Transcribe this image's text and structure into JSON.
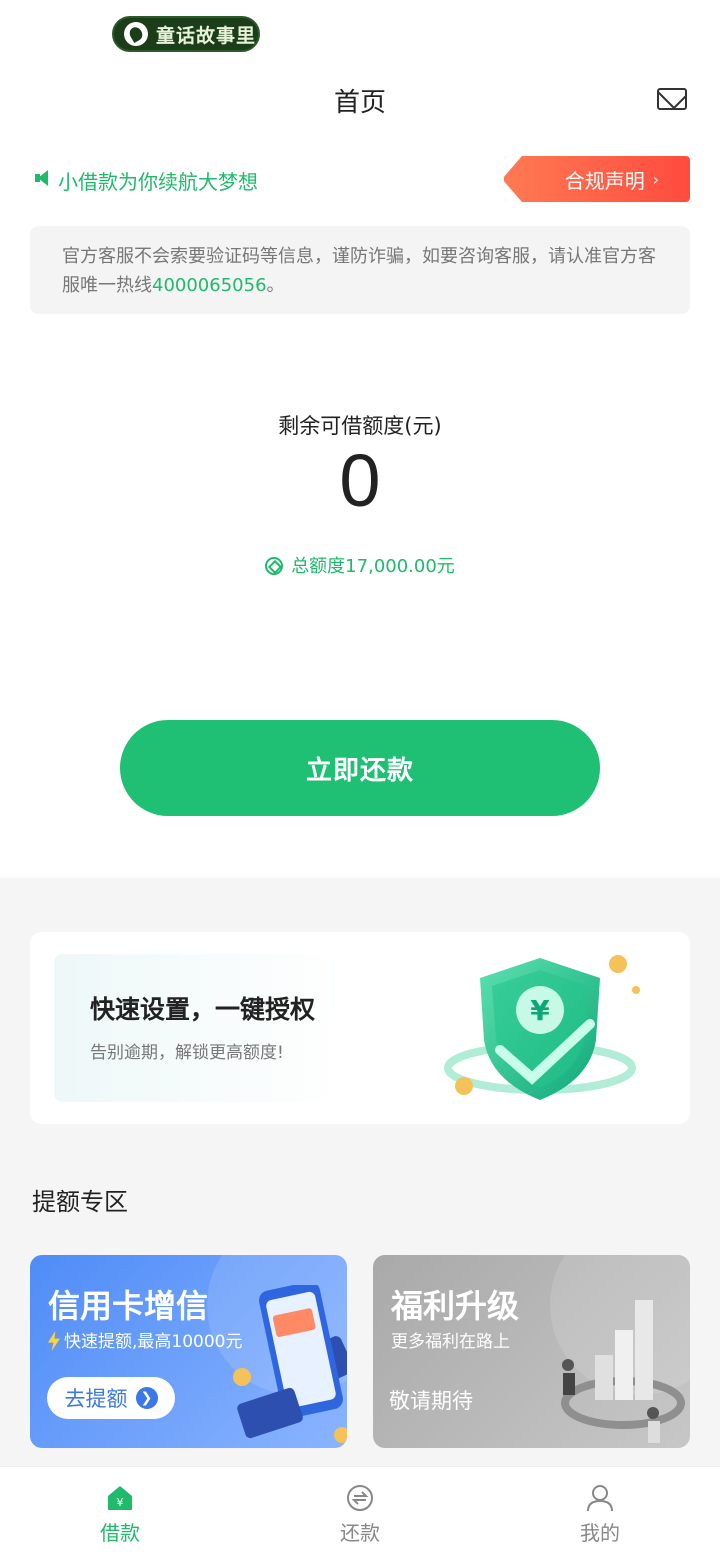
{
  "status_bar": {
    "app_label": "童话故事里"
  },
  "header": {
    "title": "首页",
    "mail_icon": "mail-icon"
  },
  "notice": {
    "slogan": "小借款为你续航大梦想",
    "compliance_label": "合规声明"
  },
  "warning": {
    "text_before": "官方客服不会索要验证码等信息，谨防诈骗，如要咨询客服，请认准官方客服唯一热线",
    "hotline": "4000065056",
    "text_after": "。"
  },
  "credit": {
    "label": "剩余可借额度(元)",
    "value": "0",
    "total_label": "总额度17,000.00元"
  },
  "repay_button": "立即还款",
  "auth_card": {
    "title": "快速设置，一键授权",
    "subtitle": "告别逾期，解锁更高额度!"
  },
  "section": {
    "title": "提额专区"
  },
  "promos": [
    {
      "title": "信用卡增信",
      "subtitle": "快速提额,最高10000元",
      "button": "去提额"
    },
    {
      "title": "福利升级",
      "subtitle": "更多福利在路上",
      "hint": "敬请期待"
    }
  ],
  "bottom_nav": [
    {
      "label": "借款",
      "icon": "home-icon",
      "active": true
    },
    {
      "label": "还款",
      "icon": "repay-icon",
      "active": false
    },
    {
      "label": "我的",
      "icon": "profile-icon",
      "active": false
    }
  ],
  "colors": {
    "brand_green": "#1fba6b",
    "button_green": "#1fc074",
    "compliance_red": "#ff4b3f",
    "promo_blue": "#4f8cf7"
  }
}
